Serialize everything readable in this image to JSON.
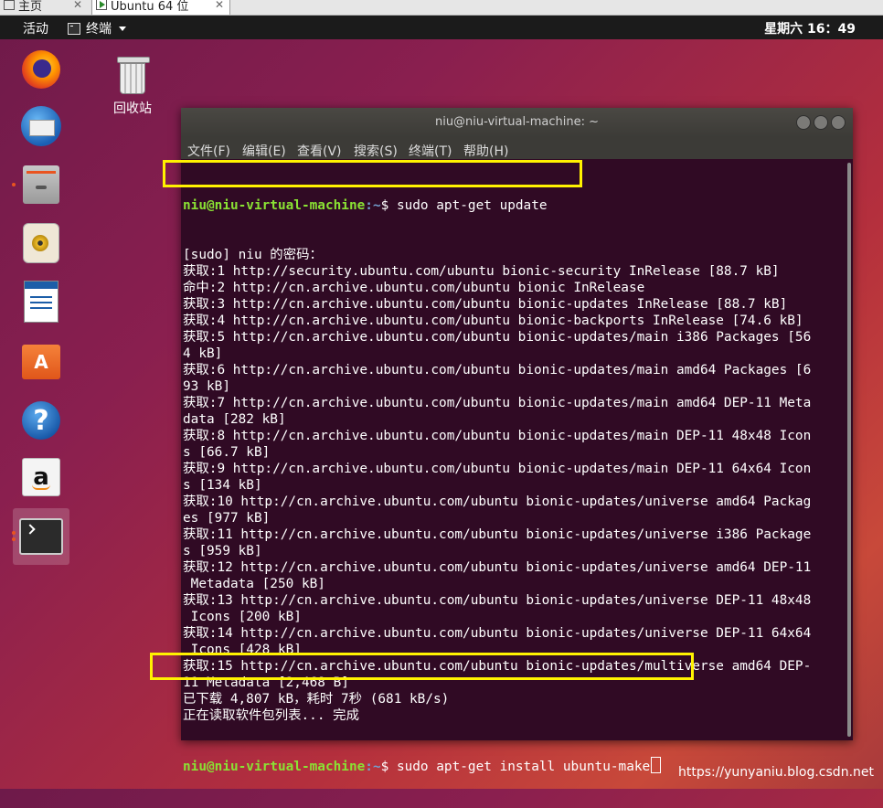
{
  "host_tabs": [
    {
      "label": "主页",
      "close": "✕"
    },
    {
      "label": "Ubuntu 64 位",
      "close": "✕"
    }
  ],
  "topbar": {
    "activities": "活动",
    "app_menu": "终端",
    "clock": "星期六 16：49"
  },
  "dock": {
    "items": [
      {
        "name": "firefox",
        "running": false
      },
      {
        "name": "thunderbird",
        "running": false
      },
      {
        "name": "files",
        "running": true
      },
      {
        "name": "rhythmbox",
        "running": false
      },
      {
        "name": "libreoffice-writer",
        "running": false
      },
      {
        "name": "ubuntu-software",
        "running": false,
        "glyph": "A"
      },
      {
        "name": "help",
        "running": false,
        "glyph": "?"
      },
      {
        "name": "amazon",
        "running": false,
        "glyph": "a"
      },
      {
        "name": "terminal",
        "running": true,
        "active": true
      }
    ]
  },
  "desktop": {
    "trash_label": "回收站"
  },
  "terminal": {
    "title": "niu@niu-virtual-machine: ~",
    "menu": [
      "文件(F)",
      "编辑(E)",
      "查看(V)",
      "搜索(S)",
      "终端(T)",
      "帮助(H)"
    ],
    "prompt_user": "niu@niu-virtual-machine",
    "prompt_path": ":~",
    "prompt_symbol": "$ ",
    "command1": "sudo apt-get update",
    "output": [
      "[sudo] niu 的密码：",
      "获取:1 http://security.ubuntu.com/ubuntu bionic-security InRelease [88.7 kB]",
      "命中:2 http://cn.archive.ubuntu.com/ubuntu bionic InRelease",
      "获取:3 http://cn.archive.ubuntu.com/ubuntu bionic-updates InRelease [88.7 kB]",
      "获取:4 http://cn.archive.ubuntu.com/ubuntu bionic-backports InRelease [74.6 kB]",
      "获取:5 http://cn.archive.ubuntu.com/ubuntu bionic-updates/main i386 Packages [56",
      "4 kB]",
      "获取:6 http://cn.archive.ubuntu.com/ubuntu bionic-updates/main amd64 Packages [6",
      "93 kB]",
      "获取:7 http://cn.archive.ubuntu.com/ubuntu bionic-updates/main amd64 DEP-11 Meta",
      "data [282 kB]",
      "获取:8 http://cn.archive.ubuntu.com/ubuntu bionic-updates/main DEP-11 48x48 Icon",
      "s [66.7 kB]",
      "获取:9 http://cn.archive.ubuntu.com/ubuntu bionic-updates/main DEP-11 64x64 Icon",
      "s [134 kB]",
      "获取:10 http://cn.archive.ubuntu.com/ubuntu bionic-updates/universe amd64 Packag",
      "es [977 kB]",
      "获取:11 http://cn.archive.ubuntu.com/ubuntu bionic-updates/universe i386 Package",
      "s [959 kB]",
      "获取:12 http://cn.archive.ubuntu.com/ubuntu bionic-updates/universe amd64 DEP-11",
      " Metadata [250 kB]",
      "获取:13 http://cn.archive.ubuntu.com/ubuntu bionic-updates/universe DEP-11 48x48",
      " Icons [200 kB]",
      "获取:14 http://cn.archive.ubuntu.com/ubuntu bionic-updates/universe DEP-11 64x64",
      " Icons [428 kB]",
      "获取:15 http://cn.archive.ubuntu.com/ubuntu bionic-updates/multiverse amd64 DEP-",
      "11 Metadata [2,468 B]",
      "已下载 4,807 kB，耗时 7秒 (681 kB/s)",
      "正在读取软件包列表... 完成"
    ],
    "command2": "sudo apt-get install ubuntu-make"
  },
  "watermark": "https://yunyaniu.blog.csdn.net",
  "colors": {
    "terminal_bg": "#300a24",
    "prompt_user": "#8ae234",
    "prompt_path": "#729fcf",
    "highlight": "#fff200"
  }
}
